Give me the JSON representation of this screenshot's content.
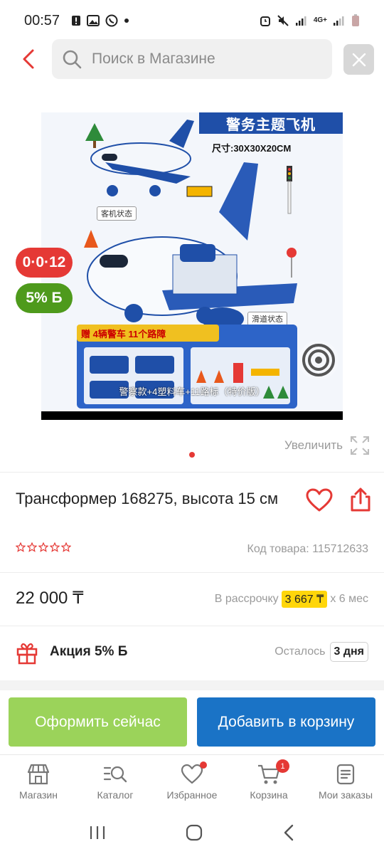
{
  "status_bar": {
    "time": "00:57",
    "network": "4G+",
    "left_icons": [
      "alert-icon",
      "image-icon",
      "whatsapp-icon",
      "dot-icon"
    ],
    "right_icons": [
      "alarm-icon",
      "mute-icon",
      "signal-icon",
      "signal-icon",
      "battery-icon"
    ]
  },
  "search": {
    "placeholder": "Поиск в Магазине"
  },
  "product_image": {
    "title_cn": "警务主题飞机",
    "size_cn": "尺寸:30X30X20CM",
    "label_passenger": "客机状态",
    "label_slide": "滑道状态",
    "bonus_cn": "赠 4辆警车 11个路障",
    "caption_cn": "警察款+4塑料车+11路标（特价版）",
    "page_index": 1,
    "pages": 1
  },
  "badges": {
    "timer": "0·0·12",
    "bonus": "5% Б"
  },
  "zoom": {
    "label": "Увеличить"
  },
  "product": {
    "title": "Трансформер 168275, высота 15 см",
    "rating_stars": 0,
    "sku_label": "Код товара: 115712633"
  },
  "price": {
    "value": "22 000 ₸",
    "installment_prefix": "В рассрочку",
    "installment_amount": "3 667 ₸",
    "installment_suffix": "х 6 мес"
  },
  "promo": {
    "label": "Акция 5% Б",
    "remaining_label": "Осталось",
    "days": "3 дня"
  },
  "actions": {
    "buy_now": "Оформить сейчас",
    "add_to_cart": "Добавить в корзину"
  },
  "bottom_nav": {
    "items": [
      {
        "label": "Магазин",
        "icon": "shop-icon"
      },
      {
        "label": "Каталог",
        "icon": "catalog-search-icon"
      },
      {
        "label": "Избранное",
        "icon": "heart-icon"
      },
      {
        "label": "Корзина",
        "icon": "cart-icon",
        "count": "1"
      },
      {
        "label": "Мои заказы",
        "icon": "orders-icon"
      }
    ]
  },
  "colors": {
    "accent_red": "#e53935",
    "buy_green": "#9bd35a",
    "cart_blue": "#1a73c6",
    "bonus_green": "#4e9a1c",
    "installment_yellow": "#ffd60a"
  }
}
